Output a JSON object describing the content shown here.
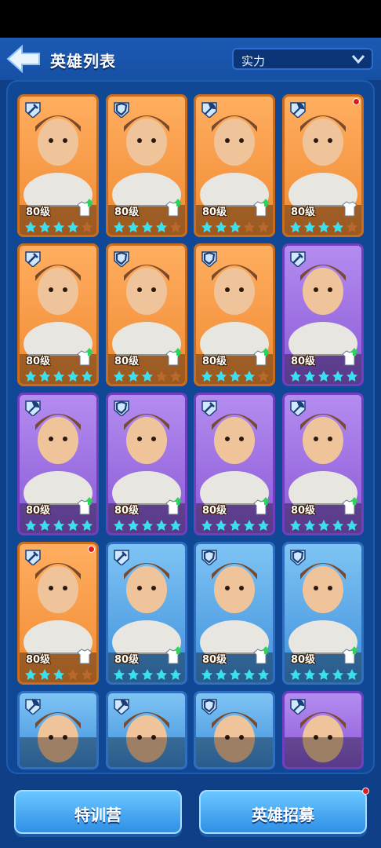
{
  "header": {
    "title": "英雄列表",
    "sort_value": "实力"
  },
  "heroes": [
    {
      "level": "80级",
      "class": "melee",
      "rarity": "orange",
      "stars": 4,
      "notify": false,
      "gear_upgrade": true
    },
    {
      "level": "80级",
      "class": "tank",
      "rarity": "orange",
      "stars": 4,
      "notify": false,
      "gear_upgrade": true
    },
    {
      "level": "80级",
      "class": "axe",
      "rarity": "orange",
      "stars": 3,
      "notify": false,
      "gear_upgrade": true
    },
    {
      "level": "80级",
      "class": "axe",
      "rarity": "orange",
      "stars": 4,
      "notify": true,
      "gear_upgrade": false
    },
    {
      "level": "80级",
      "class": "melee",
      "rarity": "orange",
      "stars": 5,
      "notify": false,
      "gear_upgrade": true
    },
    {
      "level": "80级",
      "class": "tank",
      "rarity": "orange",
      "stars": 3,
      "notify": false,
      "gear_upgrade": true
    },
    {
      "level": "80级",
      "class": "tank",
      "rarity": "orange",
      "stars": 4,
      "notify": false,
      "gear_upgrade": true
    },
    {
      "level": "80级",
      "class": "melee",
      "rarity": "purple",
      "stars": 5,
      "notify": false,
      "gear_upgrade": true
    },
    {
      "level": "80级",
      "class": "axe",
      "rarity": "purple",
      "stars": 5,
      "notify": false,
      "gear_upgrade": true
    },
    {
      "level": "80级",
      "class": "tank",
      "rarity": "purple",
      "stars": 5,
      "notify": false,
      "gear_upgrade": true
    },
    {
      "level": "80级",
      "class": "melee",
      "rarity": "purple",
      "stars": 5,
      "notify": false,
      "gear_upgrade": true
    },
    {
      "level": "80级",
      "class": "axe",
      "rarity": "purple",
      "stars": 5,
      "notify": false,
      "gear_upgrade": true
    },
    {
      "level": "80级",
      "class": "melee",
      "rarity": "orange",
      "stars": 3,
      "notify": true,
      "gear_upgrade": false
    },
    {
      "level": "80级",
      "class": "melee",
      "rarity": "blue",
      "stars": 5,
      "notify": false,
      "gear_upgrade": true
    },
    {
      "level": "80级",
      "class": "tank",
      "rarity": "blue",
      "stars": 5,
      "notify": false,
      "gear_upgrade": true
    },
    {
      "level": "80级",
      "class": "tank",
      "rarity": "blue",
      "stars": 5,
      "notify": false,
      "gear_upgrade": true
    },
    {
      "level": "",
      "class": "axe",
      "rarity": "blue",
      "stars": 0,
      "notify": false,
      "gear_upgrade": false
    },
    {
      "level": "",
      "class": "axe",
      "rarity": "blue",
      "stars": 0,
      "notify": false,
      "gear_upgrade": false
    },
    {
      "level": "",
      "class": "tank",
      "rarity": "blue",
      "stars": 0,
      "notify": false,
      "gear_upgrade": false
    },
    {
      "level": "",
      "class": "axe",
      "rarity": "purple",
      "stars": 0,
      "notify": false,
      "gear_upgrade": false
    }
  ],
  "footer": {
    "training_label": "特训营",
    "recruit_label": "英雄招募",
    "recruit_notify": true
  },
  "colors": {
    "orange": "#f08a32",
    "purple": "#8a59d6",
    "blue": "#3f8fdb",
    "notify": "#e5191a"
  }
}
